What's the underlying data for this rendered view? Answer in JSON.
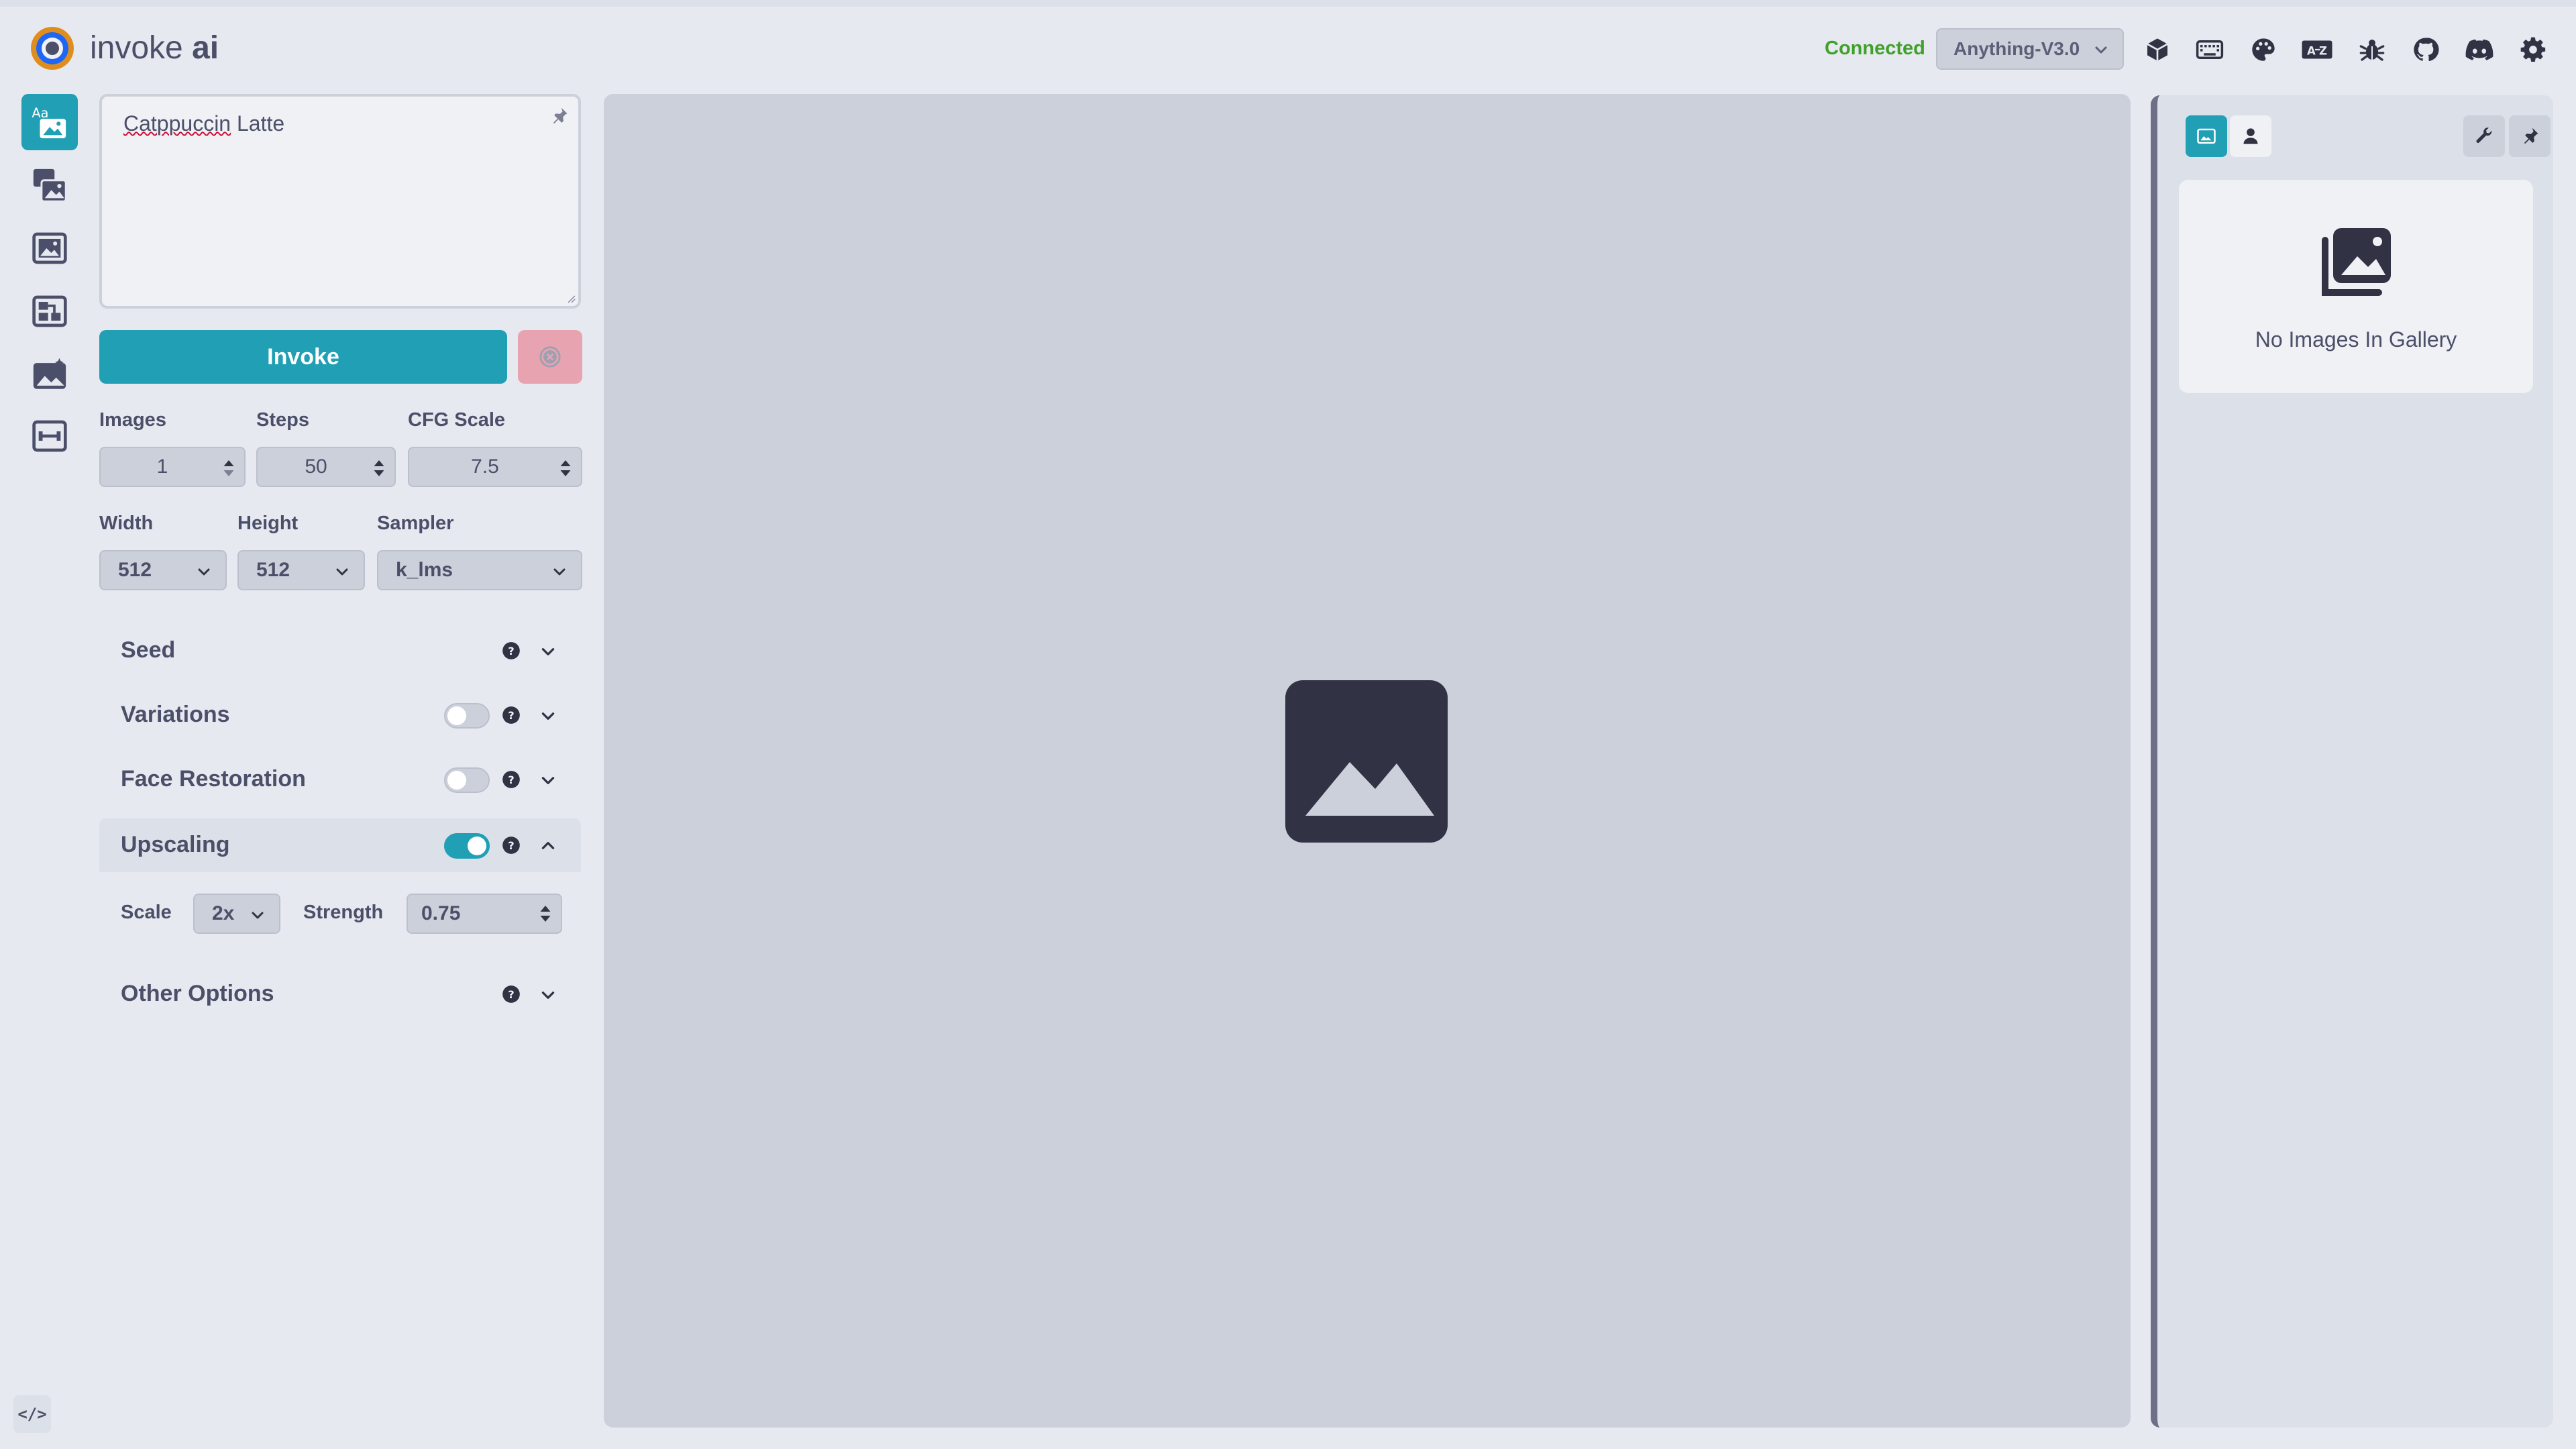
{
  "app": {
    "brand_main": "invoke",
    "brand_bold": "ai"
  },
  "header": {
    "status": "Connected",
    "model": "Anything-V3.0",
    "icons": [
      "model-manager-icon",
      "keyboard-icon",
      "palette-icon",
      "language-icon",
      "bug-icon",
      "github-icon",
      "discord-icon",
      "settings-icon"
    ]
  },
  "rail": {
    "tabs": [
      "text-to-image",
      "image-to-image",
      "unified-canvas",
      "nodes",
      "postprocessing",
      "training"
    ],
    "active": "text-to-image"
  },
  "prompt": {
    "value_misspelled": "Catppuccin",
    "value_rest": " Latte"
  },
  "actions": {
    "invoke": "Invoke"
  },
  "params": {
    "images": {
      "label": "Images",
      "value": "1"
    },
    "steps": {
      "label": "Steps",
      "value": "50"
    },
    "cfg": {
      "label": "CFG Scale",
      "value": "7.5"
    },
    "width": {
      "label": "Width",
      "value": "512"
    },
    "height": {
      "label": "Height",
      "value": "512"
    },
    "sampler": {
      "label": "Sampler",
      "value": "k_lms"
    }
  },
  "accordions": {
    "seed": {
      "title": "Seed"
    },
    "variations": {
      "title": "Variations",
      "enabled": false
    },
    "face_restoration": {
      "title": "Face Restoration",
      "enabled": false
    },
    "upscaling": {
      "title": "Upscaling",
      "enabled": true,
      "scale_label": "Scale",
      "scale_value": "2x",
      "strength_label": "Strength",
      "strength_value": "0.75"
    },
    "other": {
      "title": "Other Options"
    }
  },
  "gallery": {
    "empty_text": "No Images In Gallery"
  },
  "colors": {
    "accent": "#209fb5",
    "connected": "#40a02b",
    "cancel": "#e8a3b0",
    "panel": "#dce0e8"
  }
}
